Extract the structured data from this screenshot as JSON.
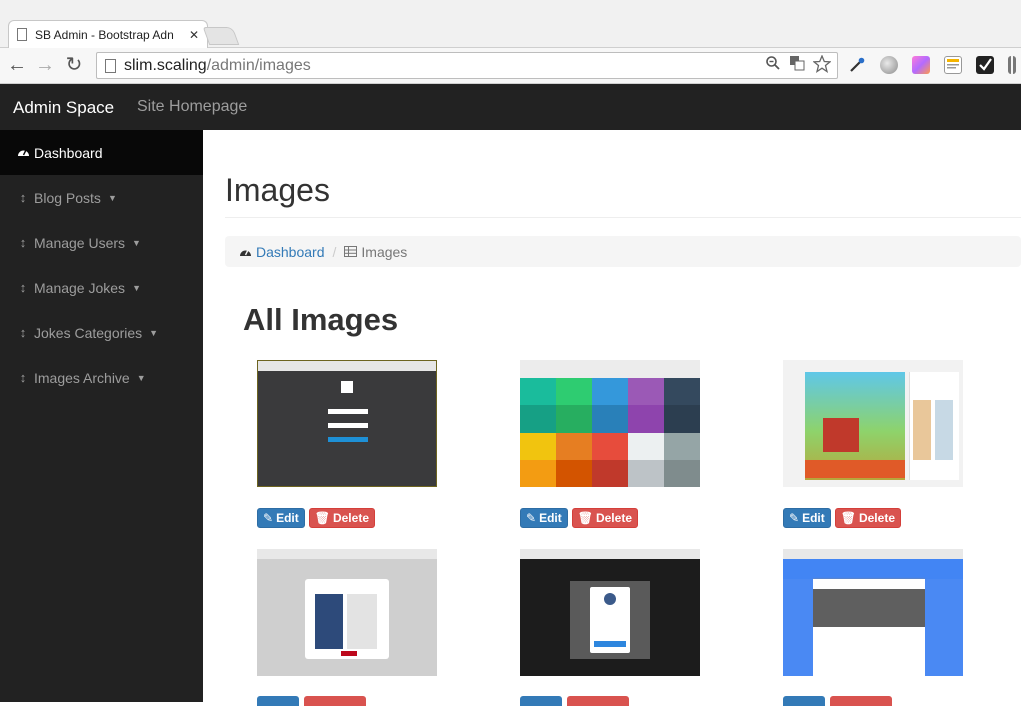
{
  "browser": {
    "tab_title": "SB Admin - Bootstrap Adn",
    "tab_close": "✕",
    "url_host": "slim.scaling",
    "url_path": "/admin/images"
  },
  "navbar": {
    "brand": "Admin Space",
    "site_link": "Site Homepage"
  },
  "sidebar": {
    "items": [
      {
        "label": "Dashboard",
        "icon": "dashboard-icon",
        "active": true
      },
      {
        "label": "Blog Posts",
        "icon": "arrows-v-icon",
        "caret": true
      },
      {
        "label": "Manage Users",
        "icon": "arrows-v-icon",
        "caret": true
      },
      {
        "label": "Manage Jokes",
        "icon": "arrows-v-icon",
        "caret": true
      },
      {
        "label": "Jokes Categories",
        "icon": "arrows-v-icon",
        "caret": true
      },
      {
        "label": "Images Archive",
        "icon": "arrows-v-icon",
        "caret": true
      }
    ]
  },
  "page": {
    "title": "Images",
    "breadcrumb": {
      "root": "Dashboard",
      "current": "Images"
    },
    "section_title": "All Images"
  },
  "buttons": {
    "edit": "Edit",
    "delete": "Delete"
  },
  "colors": {
    "primary": "#337ab7",
    "danger": "#d9534f",
    "nav_bg": "#222222"
  }
}
